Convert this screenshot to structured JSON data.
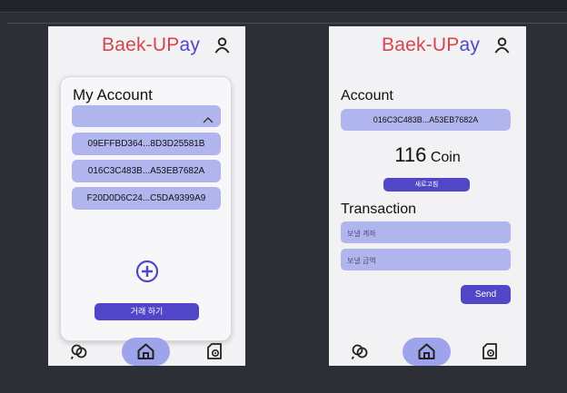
{
  "brand": {
    "part1": "Baek-",
    "part2": "UP",
    "part3": "ay"
  },
  "colors": {
    "accent": "#5146c8",
    "pill": "#b1b5ed",
    "logo_red": "#d8444b",
    "home_highlight": "#9ea4ec"
  },
  "screen1": {
    "card_title": "My Account",
    "accounts": [
      "09EFFBD364...8D3D25581B",
      "016C3C483B...A53EB7682A",
      "F20D0D6C24...C5DA9399A9"
    ],
    "trade_button": "거래 하기"
  },
  "screen2": {
    "account_heading": "Account",
    "account_id": "016C3C483B...A53EB7682A",
    "balance_value": "116",
    "balance_unit": "Coin",
    "refresh_button": "새로고침",
    "transaction_heading": "Transaction",
    "send_account_placeholder": "보낼 계좌",
    "send_amount_placeholder": "보낼 금액",
    "send_button": "Send"
  },
  "icons": [
    "user-icon",
    "chevron-up-icon",
    "plus-circle-icon",
    "exchange-icon",
    "home-icon",
    "settings-icon"
  ]
}
